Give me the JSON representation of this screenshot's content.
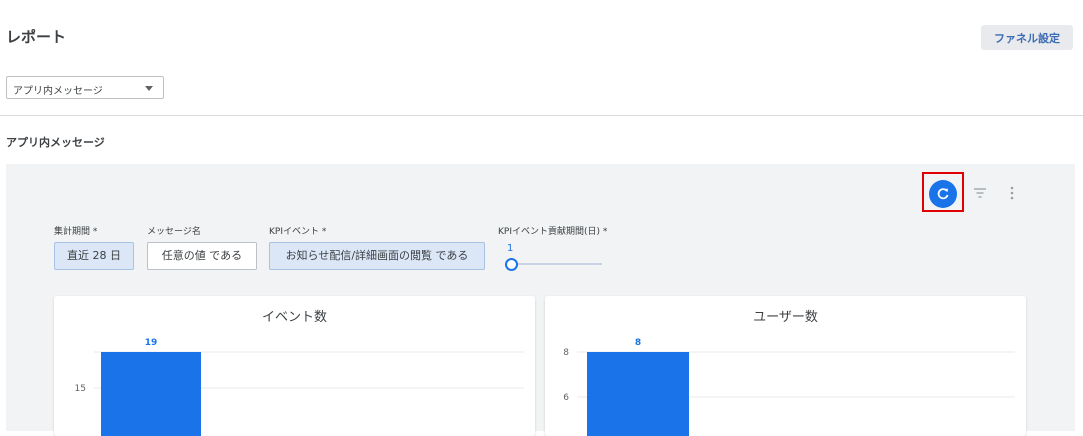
{
  "header": {
    "title": "レポート",
    "funnel_button": "ファネル設定"
  },
  "report_type_select": {
    "value": "アプリ内メッセージ"
  },
  "section": {
    "title": "アプリ内メッセージ"
  },
  "filters": {
    "period": {
      "label": "集計期間 *",
      "value": "直近 28 日"
    },
    "message_name": {
      "label": "メッセージ名",
      "value": "任意の値 である"
    },
    "kpi_event": {
      "label": "KPIイベント *",
      "value": "お知らせ配信/詳細画面の閲覧 である"
    },
    "kpi_period": {
      "label": "KPIイベント貢献期間(日) *",
      "value": "1"
    }
  },
  "icons": {
    "refresh": "refresh-icon",
    "filter": "filter-icon",
    "more": "more-vert-icon"
  },
  "colors": {
    "accent": "#1a73e8",
    "highlight": "#e00000"
  },
  "chart_data": [
    {
      "type": "bar",
      "title": "イベント数",
      "values": [
        19
      ],
      "data_labels": [
        "19"
      ],
      "yticks": [
        15
      ],
      "ylim": [
        0,
        19
      ]
    },
    {
      "type": "bar",
      "title": "ユーザー数",
      "values": [
        8
      ],
      "data_labels": [
        "8"
      ],
      "yticks": [
        6,
        8
      ],
      "ylim": [
        0,
        8
      ]
    }
  ]
}
